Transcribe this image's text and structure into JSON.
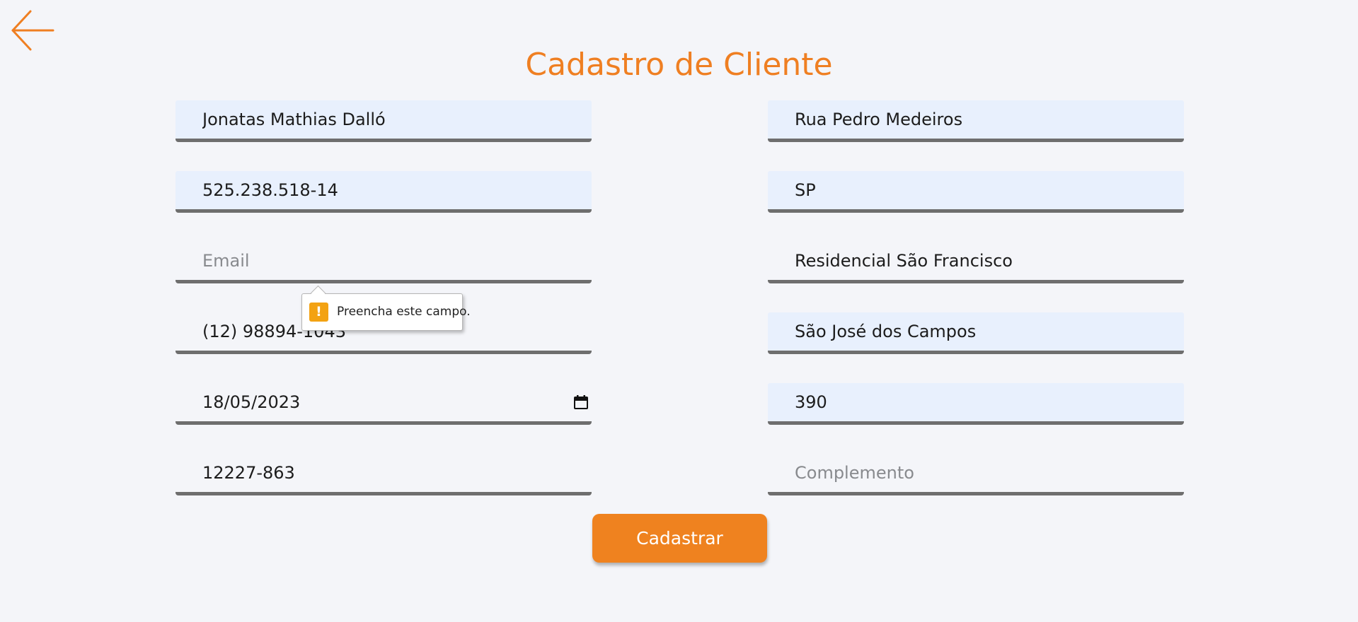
{
  "page": {
    "title": "Cadastro de Cliente"
  },
  "icons": {
    "back": "arrow-left-icon",
    "calendar": "calendar-icon",
    "warning": "warning-icon"
  },
  "colors": {
    "accent": "#ef7f22",
    "button": "#ef821f",
    "autofill_background": "#e8f0fd",
    "field_underline": "#6e6e6e",
    "page_background": "#f4f5f9"
  },
  "form": {
    "left": {
      "name": {
        "value": "Jonatas Mathias Dalló"
      },
      "cpf": {
        "value": "525.238.518-14"
      },
      "email": {
        "value": "",
        "placeholder": "Email"
      },
      "phone": {
        "value": "(12) 98894-1043"
      },
      "birth_date": {
        "value": "18/05/2023"
      },
      "cep": {
        "value": "12227-863"
      }
    },
    "right": {
      "street": {
        "value": "Rua Pedro Medeiros"
      },
      "state": {
        "value": "SP"
      },
      "neighborhood": {
        "value": "Residencial São Francisco"
      },
      "city": {
        "value": "São José dos Campos"
      },
      "number": {
        "value": "390"
      },
      "complement": {
        "value": "",
        "placeholder": "Complemento"
      }
    },
    "submit_label": "Cadastrar"
  },
  "validation_tooltip": {
    "icon": "!",
    "text": "Preencha este campo."
  }
}
